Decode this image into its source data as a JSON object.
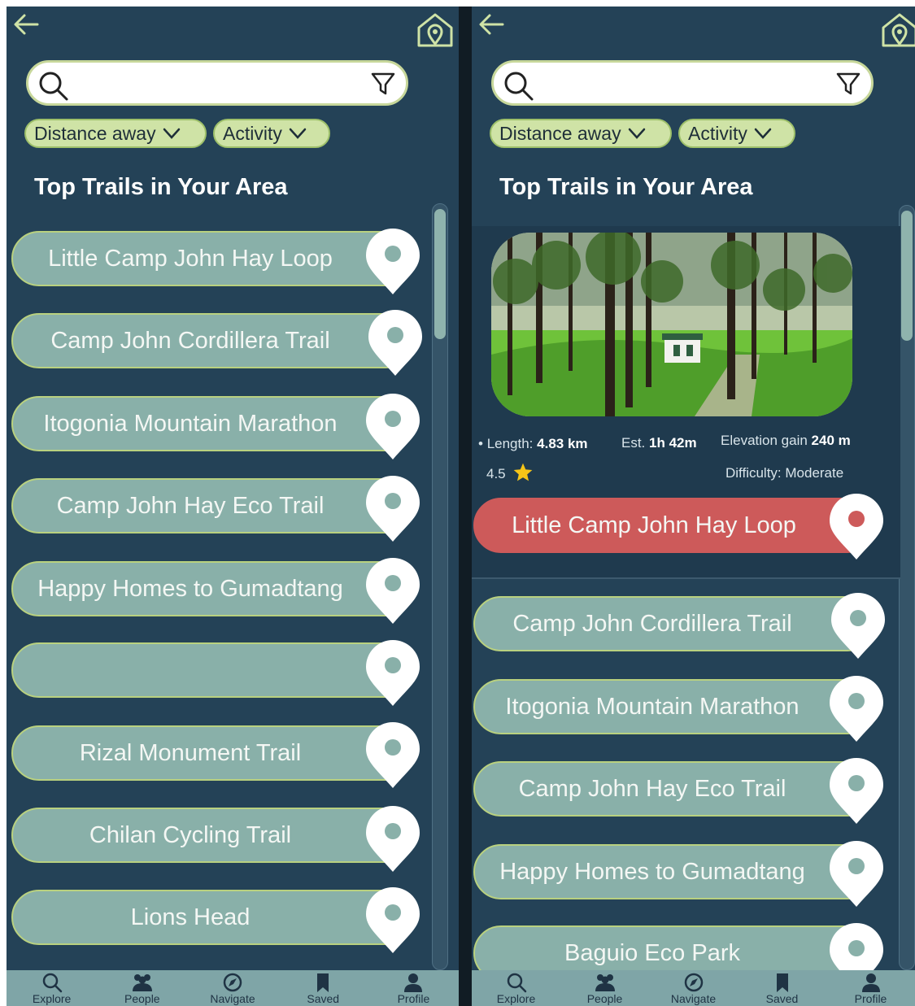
{
  "search": {
    "placeholder": ""
  },
  "filters": {
    "distance_label": "Distance away",
    "activity_label": "Activity"
  },
  "section_title": "Top Trails in Your Area",
  "left_trails": [
    "Little Camp John Hay Loop",
    "Camp John Cordillera Trail",
    "Itogonia Mountain Marathon",
    "Camp John Hay Eco Trail",
    "Happy Homes to Gumadtang",
    "",
    "Rizal Monument Trail",
    "Chilan Cycling Trail",
    "Lions Head"
  ],
  "selected_trail": {
    "name": "Little Camp John Hay Loop",
    "bullet": "•",
    "length_label": "Length:",
    "length_value": "4.83 km",
    "est_label": "Est.",
    "est_value": "1h 42m",
    "elevation_label": "Elevation gain",
    "elevation_value": "240 m",
    "rating": "4.5",
    "difficulty": "Difficulty: Moderate"
  },
  "right_trails": [
    "Camp John Cordillera Trail",
    "Itogonia Mountain Marathon",
    "Camp John Hay Eco Trail",
    "Happy Homes to Gumadtang",
    "Baguio Eco Park"
  ],
  "nav": {
    "explore": "Explore",
    "people": "People",
    "navigate": "Navigate",
    "saved": "Saved",
    "profile": "Profile"
  },
  "colors": {
    "background": "#244257",
    "trail_pill": "#89b0a9",
    "chip": "#cfe3a6",
    "active_trail": "#cd5a5a",
    "nav_bar": "#7fa5a7"
  }
}
